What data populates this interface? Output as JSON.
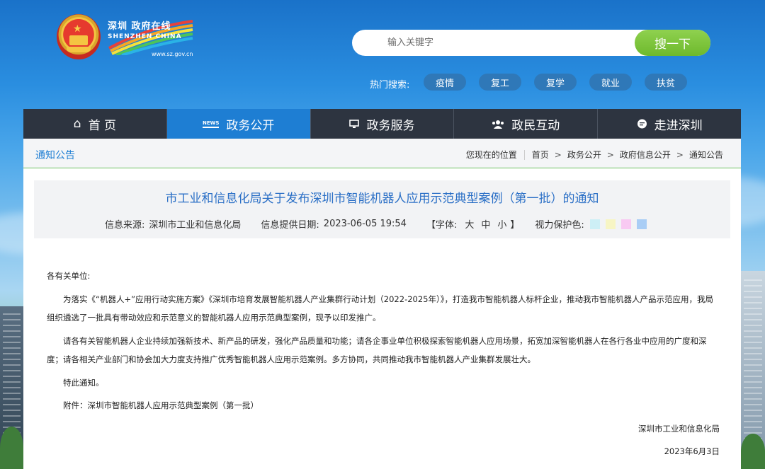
{
  "header": {
    "logo_cn": "深圳 政府在线",
    "logo_en": "SHENZHEN CHINA",
    "logo_url": "www.sz.gov.cn",
    "search": {
      "placeholder": "输入关键字",
      "button": "搜一下"
    },
    "hot_label": "热门搜索:",
    "hot_tags": [
      "疫情",
      "复工",
      "复学",
      "就业",
      "扶贫"
    ]
  },
  "nav": [
    {
      "label": "首 页",
      "icon": "home-icon"
    },
    {
      "label": "政务公开",
      "icon": "news-icon",
      "icon_text": "NEWS"
    },
    {
      "label": "政务服务",
      "icon": "monitor-icon"
    },
    {
      "label": "政民互动",
      "icon": "users-icon"
    },
    {
      "label": "走进深圳",
      "icon": "chat-icon"
    }
  ],
  "breadcrumb": {
    "section": "通知公告",
    "prefix": "您现在的位置",
    "items": [
      "首页",
      "政务公开",
      "政府信息公开",
      "通知公告"
    ],
    "sep": ">"
  },
  "article": {
    "title": "市工业和信息化局关于发布深圳市智能机器人应用示范典型案例（第一批）的通知",
    "source_label": "信息来源:",
    "source": "深圳市工业和信息化局",
    "date_label": "信息提供日期:",
    "date": "2023-06-05 19:54",
    "font_label": "【字体:",
    "font_sizes": [
      "大",
      "中",
      "小"
    ],
    "font_close": "】",
    "eye_label": "视力保护色:",
    "eye_colors": [
      "#cdeff6",
      "#f7f5c4",
      "#f8c9f2",
      "#a9cdf5"
    ],
    "salutation": "各有关单位:",
    "paragraphs": [
      "为落实《“机器人+”应用行动实施方案》《深圳市培育发展智能机器人产业集群行动计划（2022-2025年）》，打造我市智能机器人标杆企业，推动我市智能机器人产品示范应用，我局组织遴选了一批具有带动效应和示范意义的智能机器人应用示范典型案例，现予以印发推广。",
      "请各有关智能机器人企业持续加强新技术、新产品的研发，强化产品质量和功能；请各企事业单位积极探索智能机器人应用场景，拓宽加深智能机器人在各行各业中应用的广度和深度；请各相关产业部门和协会加大力度支持推广优秀智能机器人应用示范案例。多方协同，共同推动我市智能机器人产业集群发展壮大。"
    ],
    "notice": "特此通知。",
    "attachment": "附件：深圳市智能机器人应用示范典型案例（第一批）",
    "signature": "深圳市工业和信息化局",
    "sign_date": "2023年6月3日"
  }
}
